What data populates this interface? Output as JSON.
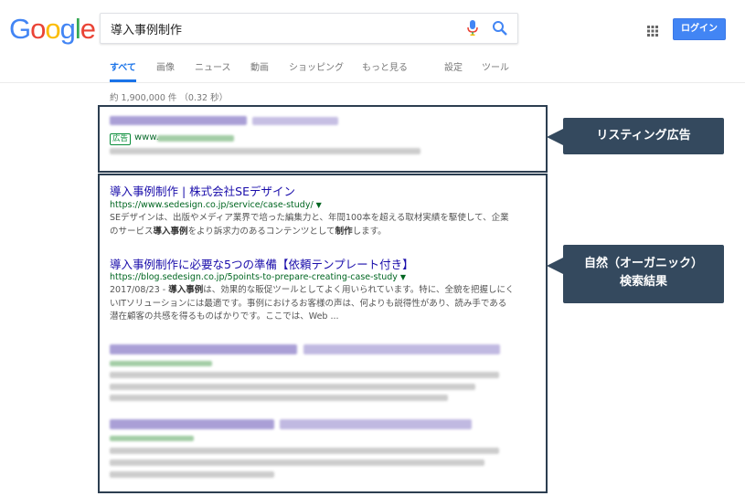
{
  "header": {
    "logo_letters": [
      {
        "ch": "G",
        "color": "#4285F4"
      },
      {
        "ch": "o",
        "color": "#EA4335"
      },
      {
        "ch": "o",
        "color": "#FBBC05"
      },
      {
        "ch": "g",
        "color": "#4285F4"
      },
      {
        "ch": "l",
        "color": "#34A853"
      },
      {
        "ch": "e",
        "color": "#EA4335"
      }
    ],
    "query": "導入事例制作",
    "login_label": "ログイン"
  },
  "tabs": [
    "すべて",
    "画像",
    "ニュース",
    "動画",
    "ショッピング",
    "もっと見る",
    "設定",
    "ツール"
  ],
  "stats": "約 1,900,000 件 （0.32 秒）",
  "ad": {
    "badge": "広告",
    "url_prefix": "www."
  },
  "results": [
    {
      "title": "導入事例制作 | 株式会社SEデザイン",
      "url": "https://www.sedesign.co.jp/service/case-study/",
      "snippet_lines": [
        [
          "SEデザインは、出版やメディア業界で培った編集力と、年間100本を超える取材実績を駆使して、企業"
        ],
        [
          "のサービス",
          "導入事例",
          "をより訴求力のあるコンテンツとして",
          "制作",
          "します。"
        ]
      ]
    },
    {
      "title": "導入事例制作に必要な5つの準備【依頼テンプレート付き】",
      "url": "https://blog.sedesign.co.jp/5points-to-prepare-creating-case-study",
      "snippet_lines": [
        [
          "2017/08/23 - ",
          "導入事例",
          "は、効果的な販促ツールとしてよく用いられています。特に、全貌を把握しにく"
        ],
        [
          "いITソリューションには最適です。事例におけるお客様の声は、何よりも説得性があり、読み手である"
        ],
        [
          "潜在顧客の共感を得るものばかりです。ここでは、Web ..."
        ]
      ]
    }
  ],
  "callouts": {
    "ad": "リスティング広告",
    "organic_line1": "自然（オーガニック）",
    "organic_line2": "検索結果"
  },
  "colors": {
    "link": "#1a0dab",
    "url_green": "#006621",
    "callout_bg": "#34495e",
    "accent_blue": "#4285f4"
  }
}
